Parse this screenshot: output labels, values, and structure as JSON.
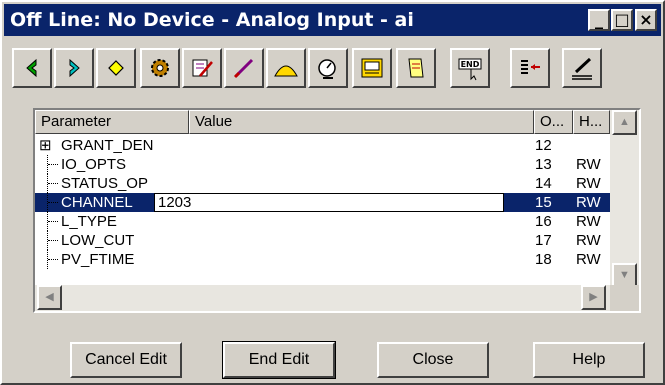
{
  "window": {
    "title": "Off Line: No Device - Analog Input - ai"
  },
  "title_buttons": {
    "minimize": "_",
    "maximize": "□",
    "close": "×"
  },
  "toolbar": {
    "tools": [
      {
        "name": "back",
        "icon": "green-left-arrow-icon"
      },
      {
        "name": "forward",
        "icon": "green-right-arrow-icon"
      },
      {
        "name": "diamond",
        "icon": "yellow-diamond-icon"
      },
      {
        "name": "gear",
        "icon": "gear-icon"
      },
      {
        "name": "edit-form",
        "icon": "form-pencil-icon"
      },
      {
        "name": "probe",
        "icon": "probe-icon"
      },
      {
        "name": "trend",
        "icon": "trend-curve-icon"
      },
      {
        "name": "gauge",
        "icon": "gauge-icon"
      },
      {
        "name": "monitor",
        "icon": "monitor-icon"
      },
      {
        "name": "scroll",
        "icon": "scroll-icon"
      },
      {
        "name": "end",
        "icon": "end-cursor-icon",
        "text": "END"
      },
      {
        "name": "list-arrow",
        "icon": "list-arrow-icon"
      },
      {
        "name": "write",
        "icon": "pen-write-icon"
      }
    ]
  },
  "grid": {
    "headers": [
      "Parameter",
      "Value",
      "O...",
      "H..."
    ],
    "rows": [
      {
        "tree": "⊞",
        "parameter": "GRANT_DEN",
        "value": "",
        "o": "12",
        "h": ""
      },
      {
        "tree": "",
        "parameter": "IO_OPTS",
        "value": "",
        "o": "13",
        "h": "RW"
      },
      {
        "tree": "",
        "parameter": "STATUS_OP",
        "value": "",
        "o": "14",
        "h": "RW"
      },
      {
        "tree": "",
        "parameter": "CHANNEL",
        "value": "1203",
        "o": "15",
        "h": "RW",
        "selected": true
      },
      {
        "tree": "",
        "parameter": "L_TYPE",
        "value": "",
        "o": "16",
        "h": "RW"
      },
      {
        "tree": "",
        "parameter": "LOW_CUT",
        "value": "",
        "o": "17",
        "h": "RW"
      },
      {
        "tree": "",
        "parameter": "PV_FTIME",
        "value": "",
        "o": "18",
        "h": "RW"
      }
    ]
  },
  "buttons": {
    "cancel": "Cancel Edit",
    "end": "End Edit",
    "close": "Close",
    "help": "Help"
  }
}
